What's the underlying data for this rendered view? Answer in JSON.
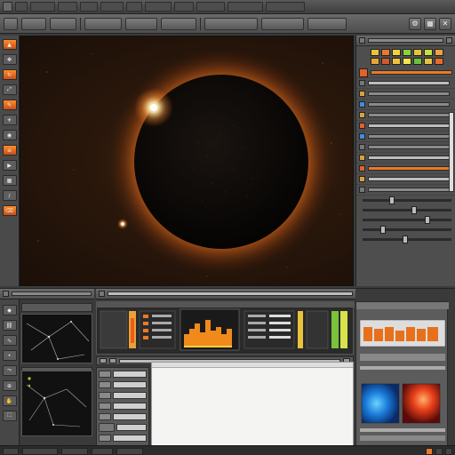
{
  "menubar": {
    "items": [
      "",
      "",
      "",
      "",
      "",
      "",
      "",
      "",
      "",
      "",
      ""
    ]
  },
  "toolbar": {
    "buttons": [
      "",
      "",
      "",
      "",
      "",
      "",
      "",
      "",
      ""
    ],
    "right_icons": [
      "settings-icon",
      "layout-icon",
      "close-icon"
    ]
  },
  "left_tools": [
    "select-icon",
    "move-icon",
    "rotate-icon",
    "scale-icon",
    "paint-icon",
    "light-icon",
    "camera-icon",
    "layers-icon",
    "render-icon",
    "grid-icon",
    "brush-icon",
    "erase-icon"
  ],
  "viewport": {
    "scene": "solar-eclipse"
  },
  "inspector": {
    "swatch_colors": [
      "#e8c23a",
      "#e87a2a",
      "#f0d23a",
      "#8ad23a",
      "#e8c23a",
      "#c8e23a",
      "#f0a23a",
      "#e8a23a",
      "#d25a2a",
      "#f0c23a",
      "#f2e64a",
      "#6ac23a",
      "#e8c23a",
      "#e86a2a"
    ],
    "rows": [
      "",
      "",
      "",
      "",
      "",
      "",
      "",
      "",
      "",
      "",
      "",
      "",
      "",
      "",
      "",
      ""
    ]
  },
  "timeline": {
    "buttons": 4
  },
  "colors": {
    "accent": "#e87a2a",
    "panel": "#4e4e4e",
    "viewport_bg": "#1a0f08",
    "corona": "#ff8a2a"
  }
}
